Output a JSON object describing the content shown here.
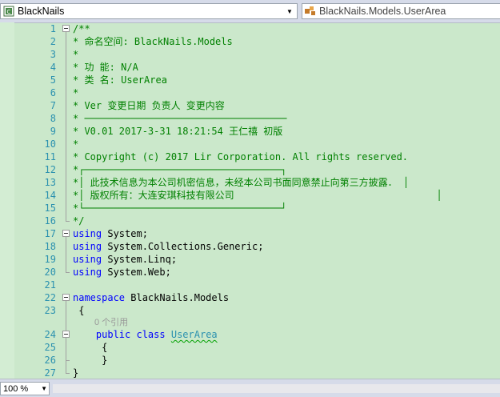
{
  "navbar": {
    "project_name": "BlackNails",
    "type_name": "BlackNails.Models.UserArea",
    "project_icon": "csharp-project-icon",
    "type_icon": "class-icon",
    "dropdown_icon": "chevron-down-icon"
  },
  "editor": {
    "line_numbers": [
      "1",
      "2",
      "3",
      "4",
      "5",
      "6",
      "7",
      "8",
      "9",
      "10",
      "11",
      "12",
      "13",
      "14",
      "15",
      "16",
      "17",
      "18",
      "19",
      "20",
      "21",
      "22",
      "23",
      "24",
      "25",
      "26",
      "27"
    ],
    "lines": [
      {
        "n": 1,
        "text": "/**"
      },
      {
        "n": 2,
        "text": "* 命名空间: BlackNails.Models"
      },
      {
        "n": 3,
        "text": "*"
      },
      {
        "n": 4,
        "text": "* 功 能: N/A"
      },
      {
        "n": 5,
        "text": "* 类 名: UserArea"
      },
      {
        "n": 6,
        "text": "*"
      },
      {
        "n": 7,
        "text": "* Ver 变更日期 负责人 变更内容"
      },
      {
        "n": 8,
        "text": "* ───────────────────────────────────"
      },
      {
        "n": 9,
        "text": "* V0.01 2017-3-31 18:21:54 王仁禧 初版"
      },
      {
        "n": 10,
        "text": "*"
      },
      {
        "n": 11,
        "text": "* Copyright (c) 2017 Lir Corporation. All rights reserved."
      },
      {
        "n": 12,
        "text": "*┌──────────────────────────────────┐"
      },
      {
        "n": 13,
        "text": "*│ 此技术信息为本公司机密信息，未经本公司书面同意禁止向第三方披露． │"
      },
      {
        "n": 14,
        "text": "*│ 版权所有：大连安琪科技有限公司                                   │"
      },
      {
        "n": 15,
        "text": "*└──────────────────────────────────┘"
      },
      {
        "n": 16,
        "text": "*/"
      }
    ],
    "usings": [
      {
        "kw": "using",
        "ns": " System;"
      },
      {
        "kw": "using",
        "ns": " System.Collections.Generic;"
      },
      {
        "kw": "using",
        "ns": " System.Linq;"
      },
      {
        "kw": "using",
        "ns": " System.Web;"
      }
    ],
    "namespace_kw": "namespace",
    "namespace_name": " BlackNails.Models",
    "open_brace": "{",
    "close_brace": "}",
    "codelens": "0 个引用",
    "class_modifiers": "public class",
    "class_name": "UserArea",
    "class_open": "{",
    "class_close": "}"
  },
  "status": {
    "zoom": "100 %"
  },
  "colors": {
    "background": "#cbe8cb",
    "comment": "#008000",
    "keyword": "#0000ff",
    "type": "#2b91af",
    "line_number": "#2b91af"
  }
}
